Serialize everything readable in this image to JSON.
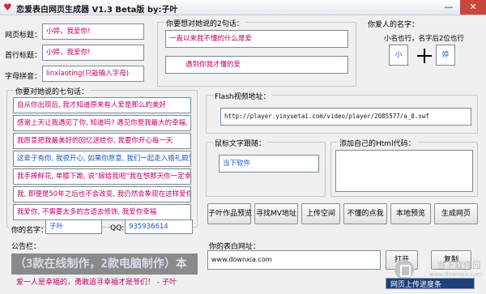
{
  "window": {
    "title": "恋爱表白网页生成器 V1.3 Beta版  by:子叶",
    "min_glyph": "—",
    "close_glyph": "✕",
    "icon": "heart-icon"
  },
  "left_fields": {
    "page_title_label": "网页标题：",
    "page_title_value": "小婷，我爱你!",
    "first_line_label": "首行标题：",
    "first_line_value": "小婷，我爱你!",
    "pinyin_label": "字母拼音：",
    "pinyin_value": "linxiaoting(只能输入字母)"
  },
  "two_lines": {
    "label": "你要想对她说的2句话：",
    "line1": "一直以来我不懂的什么是爱",
    "line2": "遇到你我才懂的爱"
  },
  "names": {
    "label": "你爱人的名字：",
    "hint": "小名也行，名字后2位也行",
    "left": "小",
    "right": "婷"
  },
  "seven_lines": {
    "label": "你要对她说的七句话：",
    "lines": [
      "自从你出现后, 我才知道原来有人爱是那么的美好",
      "感谢上天让我遇见了你, 知道吗? 遇见你是我最大的幸福, 遇见",
      "我愿意把我最美好的回忆送给你, 我要你开心每一天",
      "这辈子有你, 我很开心, 如果你愿意, 我们一起走入婚礼殿堂",
      "我手捧鲜花, 单膝下跪, 说“嫁给我吧”我在想那天你一定幸",
      "我, 即便是50年之后也不会改变, 我仍然会象现在这样爱你",
      "我爱你, 不需要太多的言语去修饰, 我爱你幸福"
    ]
  },
  "your_name": {
    "label": "你的名字：",
    "value": "子叶"
  },
  "qq": {
    "label": "QQ:",
    "value": "935936614"
  },
  "flash": {
    "label": "Flash视频地址：",
    "value": "http://player.yinyuetai.com/video/player/2085577/a_0.swf"
  },
  "mouse_text": {
    "label": "鼠标文字跟随：",
    "value": "当下软件"
  },
  "custom_html": {
    "label": "添加自己的Html代码：",
    "value": ""
  },
  "action_buttons": {
    "preview_work": "子叶作品预览",
    "find_mv": "寻找MV地址",
    "upload_space": "上传空间",
    "unknown_click": "不懂的点我",
    "local_preview": "本地预览",
    "generate": "生成网页"
  },
  "notice": {
    "label": "公告栏：",
    "ticker": "（3款在线制作，2款电脑制作）本",
    "message": "爱一人是幸福的，勇敢追寻幸福才是爷们！ - 子叶"
  },
  "confession_url": {
    "label": "你的表白网址：",
    "value": "www.downxia.com",
    "open": "打开",
    "copy": "复制"
  },
  "upload_progress": {
    "text": "网页上传进度条",
    "fraction": 1.0
  },
  "watermark": {
    "line1": "当下软件园",
    "line2": "www.downxia.com",
    "icon": "downxia-logo-icon"
  }
}
